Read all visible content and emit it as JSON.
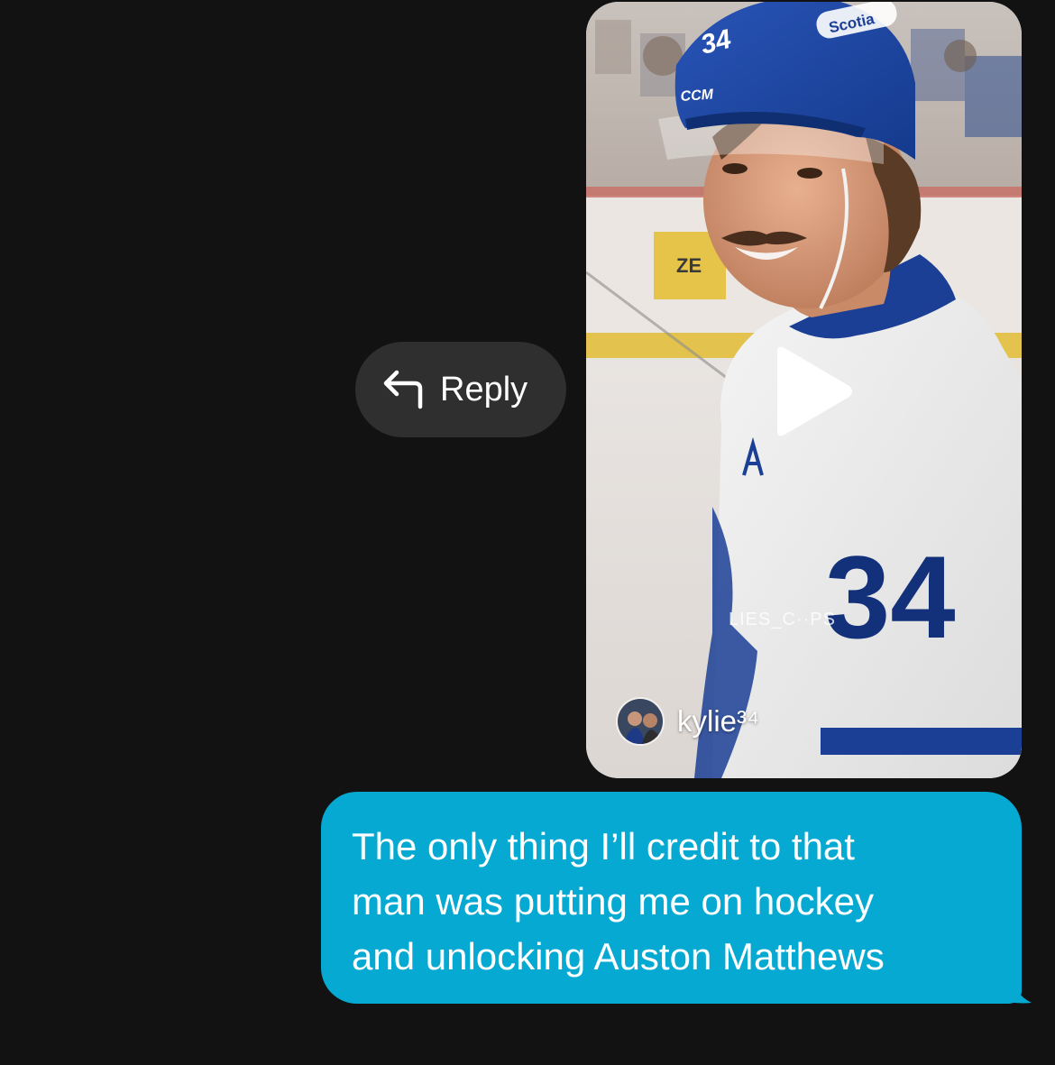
{
  "reply": {
    "label": "Reply",
    "icon": "reply-arrow-icon"
  },
  "shared_video": {
    "icons": [
      "play-icon"
    ],
    "image_text": {
      "helmet_sponsor": "Scotia",
      "helmet_number": "34",
      "helmet_brand": "CCM",
      "board_ad": "ZE",
      "jersey_number": "34"
    },
    "watermark": "LIES_C··PS",
    "author": {
      "name": "kylie³⁴",
      "avatar": "author-avatar"
    }
  },
  "message": {
    "text": "The only thing I’ll credit to that\nman was putting me on hockey\nand unlocking Auston Matthews",
    "bubble_color": "#06a9d2"
  },
  "colors": {
    "background": "#121212",
    "reply_pill": "#2f2f2f"
  }
}
